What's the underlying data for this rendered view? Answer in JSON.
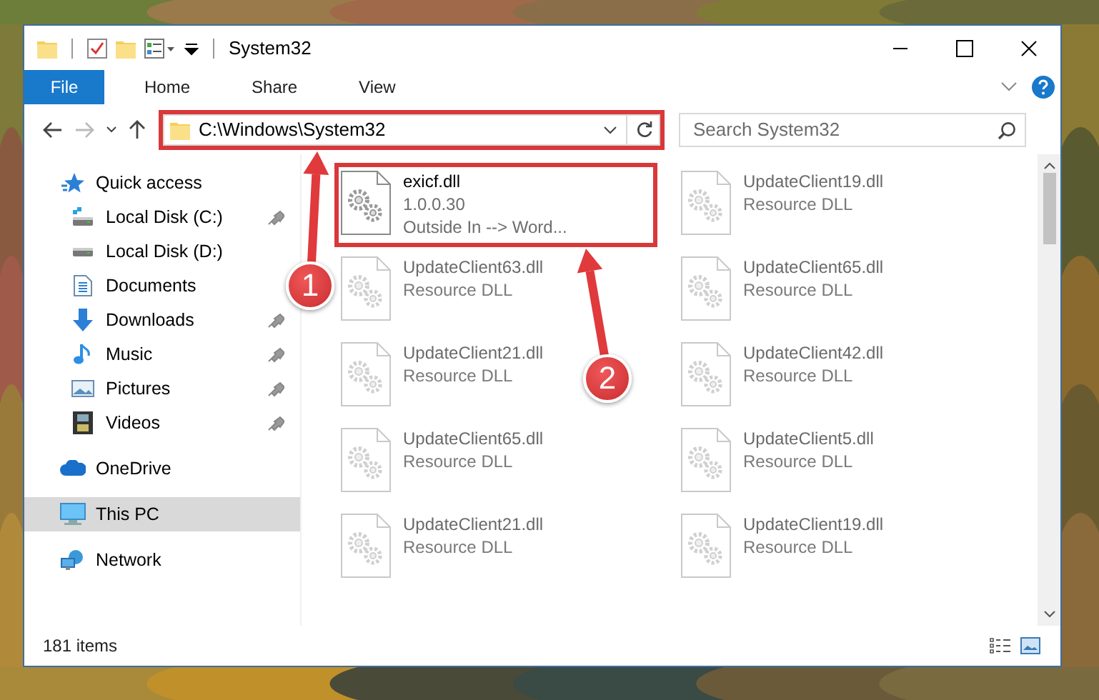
{
  "window": {
    "title": "System32"
  },
  "ribbon": {
    "tabs": [
      {
        "label": "File",
        "kind": "file",
        "selected": false
      },
      {
        "label": "Home",
        "kind": "tab",
        "selected": false
      },
      {
        "label": "Share",
        "kind": "tab",
        "selected": false
      },
      {
        "label": "View",
        "kind": "tab",
        "selected": false
      }
    ]
  },
  "address_bar": {
    "path": "C:\\Windows\\System32",
    "highlighted": true
  },
  "search": {
    "placeholder": "Search System32"
  },
  "navigation": {
    "items": [
      {
        "label": "Quick access",
        "selected": false,
        "children": [
          {
            "label": "Local Disk (C:)",
            "pinned": true,
            "selected": false
          },
          {
            "label": "Local Disk (D:)",
            "pinned": false,
            "selected": false
          },
          {
            "label": "Documents",
            "pinned": false,
            "selected": false
          },
          {
            "label": "Downloads",
            "pinned": true,
            "selected": false
          },
          {
            "label": "Music",
            "pinned": true,
            "selected": false
          },
          {
            "label": "Pictures",
            "pinned": true,
            "selected": false
          },
          {
            "label": "Videos",
            "pinned": true,
            "selected": false
          }
        ]
      },
      {
        "label": "OneDrive",
        "selected": false
      },
      {
        "label": "This PC",
        "selected": true
      },
      {
        "label": "Network",
        "selected": false
      }
    ]
  },
  "files": [
    {
      "name": "exicf.dll",
      "lines": [
        "1.0.0.30",
        "Outside In --> Word..."
      ],
      "highlighted": true,
      "blurred": false
    },
    {
      "name": "UpdateClient19.dll",
      "lines": [
        "Resource DLL"
      ],
      "highlighted": false,
      "blurred": true
    },
    {
      "name": "UpdateClient63.dll",
      "lines": [
        "Resource DLL"
      ],
      "highlighted": false,
      "blurred": true
    },
    {
      "name": "UpdateClient65.dll",
      "lines": [
        "Resource DLL"
      ],
      "highlighted": false,
      "blurred": true
    },
    {
      "name": "UpdateClient21.dll",
      "lines": [
        "Resource DLL"
      ],
      "highlighted": false,
      "blurred": true
    },
    {
      "name": "UpdateClient42.dll",
      "lines": [
        "Resource DLL"
      ],
      "highlighted": false,
      "blurred": true
    },
    {
      "name": "UpdateClient65.dll",
      "lines": [
        "Resource DLL"
      ],
      "highlighted": false,
      "blurred": true
    },
    {
      "name": "UpdateClient5.dll",
      "lines": [
        "Resource DLL"
      ],
      "highlighted": false,
      "blurred": true
    },
    {
      "name": "UpdateClient21.dll",
      "lines": [
        "Resource DLL"
      ],
      "highlighted": false,
      "blurred": true
    },
    {
      "name": "UpdateClient19.dll",
      "lines": [
        "Resource DLL"
      ],
      "highlighted": false,
      "blurred": true
    }
  ],
  "status_bar": {
    "item_count": "181 items"
  },
  "annotations": [
    {
      "number": "1",
      "kind": "address"
    },
    {
      "number": "2",
      "kind": "file"
    }
  ]
}
